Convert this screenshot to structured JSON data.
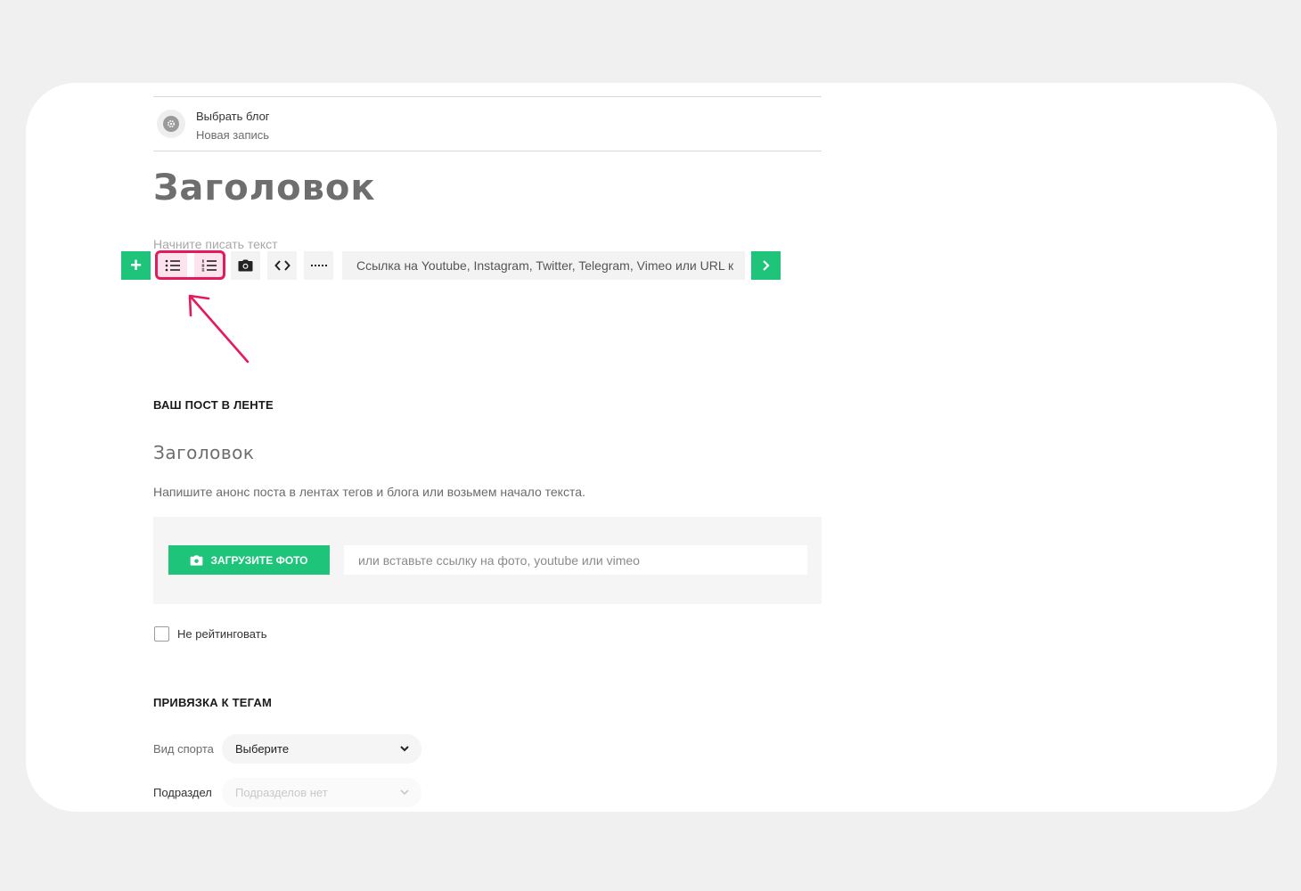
{
  "blog": {
    "name": "Выбрать блог",
    "subtitle": "Новая запись"
  },
  "editor": {
    "title_placeholder": "Заголовок",
    "body_placeholder": "Начните писать текст",
    "toolbar": {
      "add_label": "+",
      "embed_placeholder": "Ссылка на Youtube, Instagram, Twitter, Telegram, Vimeo или URL к"
    }
  },
  "feed_preview": {
    "heading": "ВАШ ПОСТ В ЛЕНТЕ",
    "title": "Заголовок",
    "description": "Напишите анонс поста в лентах тегов и блога или возьмем начало текста.",
    "upload_button": "ЗАГРУЗИТЕ ФОТО",
    "url_placeholder": "или вставьте ссылку на фото, youtube или vimeo"
  },
  "rating": {
    "checkbox_label": "Не рейтинговать",
    "checked": false
  },
  "tags": {
    "heading": "ПРИВЯЗКА К ТЕГАМ",
    "sport_label": "Вид спорта",
    "sport_value": "Выберите",
    "subsection_label": "Подраздел",
    "subsection_value": "Подразделов нет"
  },
  "colors": {
    "accent": "#1ec47a",
    "highlight": "#e6195a"
  }
}
